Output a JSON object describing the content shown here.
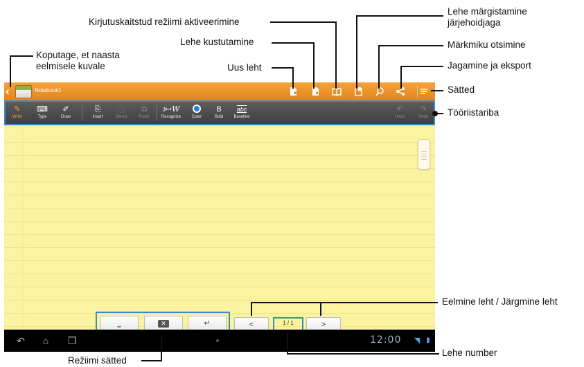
{
  "app": {
    "notebook_title": "Notebook1"
  },
  "title_actions": [
    {
      "name": "new-page-icon"
    },
    {
      "name": "delete-page-icon"
    },
    {
      "name": "read-only-icon"
    },
    {
      "name": "bookmark-page-icon"
    },
    {
      "name": "search-icon"
    },
    {
      "name": "share-icon"
    },
    {
      "name": "settings-menu-icon"
    }
  ],
  "toolbar": {
    "write": "Write",
    "type": "Type",
    "draw": "Draw",
    "insert": "Insert",
    "select": "Select",
    "paste": "Paste",
    "recognize": "Recognize",
    "recognize_glyph": "ነ↦W",
    "color": "Color",
    "bold": "Bold",
    "bold_glyph": "B",
    "baseline": "Baseline",
    "baseline_glyph": "abc",
    "undo": "Undo",
    "redo": "Redo"
  },
  "bottom_controls": {
    "prev": "<",
    "next": ">",
    "page_number": "1 / 1"
  },
  "status": {
    "clock": "12:00"
  },
  "accent_colors": {
    "title_bar": "#e8891f",
    "callout_frame": "#3a8bc9",
    "paper": "#fbf39f"
  },
  "callouts": {
    "back": "Koputage, et naasta eelmisele kuvale",
    "read_only": "Kirjutuskaitstud režiimi aktiveerimine",
    "delete_page": "Lehe kustutamine",
    "new_page": "Uus leht",
    "bookmark": "Lehe märgistamine järjehoidjaga",
    "search": "Märkmiku otsimine",
    "share": "Jagamine ja eksport",
    "settings": "Sätted",
    "toolbar": "Tööriistariba",
    "prev_next": "Eelmine leht / Järgmine leht",
    "page_number": "Lehe number",
    "mode_settings": "Režiimi sätted"
  }
}
